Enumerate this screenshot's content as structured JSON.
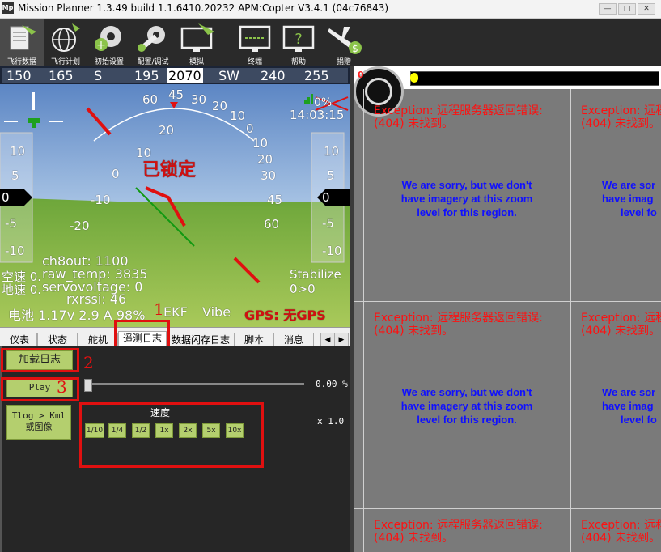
{
  "window": {
    "title": "Mission Planner 1.3.49 build 1.1.6410.20232 APM:Copter V3.4.1 (04c76843)",
    "app_icon": "Mp"
  },
  "toolbar": {
    "items": [
      {
        "label": "飞行数据",
        "icon": "flight-data-icon"
      },
      {
        "label": "飞行计划",
        "icon": "globe-icon"
      },
      {
        "label": "初始设置",
        "icon": "gear-plus-icon"
      },
      {
        "label": "配置/调试",
        "icon": "wrench-gear-icon"
      },
      {
        "label": "模拟",
        "icon": "simulation-monitor-icon"
      },
      {
        "label": "终端",
        "icon": "terminal-monitor-icon"
      },
      {
        "label": "帮助",
        "icon": "help-monitor-icon"
      },
      {
        "label": "捐赠",
        "icon": "donate-plane-icon"
      }
    ]
  },
  "compass": {
    "labels": [
      "150",
      "165",
      "S",
      "195",
      "2070",
      "SW",
      "240",
      "255"
    ]
  },
  "hud": {
    "locked": "已锁定",
    "time": "14:03:15",
    "battery_pct": "0%",
    "pitch_labels": [
      "60",
      "45",
      "30",
      "20",
      "10",
      "0",
      "-10",
      "-20"
    ],
    "roll_labels": [
      "30",
      "20",
      "10",
      "0",
      "10",
      "20",
      "30",
      "45",
      "60"
    ],
    "left_scale": [
      "10",
      "5",
      "0",
      "-5",
      "-10"
    ],
    "right_scale": [
      "10",
      "5",
      "0",
      "-5",
      "-10"
    ],
    "left_value": "0",
    "right_value": "0",
    "airspeed_label": "空速 0.",
    "groundspeed_label": "地速 0.",
    "ch8out": "ch8out: 1100",
    "raw_temp": "raw_temp: 3835",
    "servovoltage": "servovoltage: 0",
    "rxrssi": "rxrssi: 46",
    "mode": "Stabilize",
    "wp": "0>0",
    "battery": "电池 1.17v 2.9 A 98%",
    "ekf": "EKF",
    "vibe": "Vibe",
    "gps": "GPS: 无GPS"
  },
  "tabs": {
    "items": [
      "仪表",
      "状态",
      "舵机",
      "遥测日志",
      "数据闪存日志",
      "脚本",
      "消息"
    ],
    "active": "遥测日志"
  },
  "tlog": {
    "load_log": "加载日志",
    "play": "Play",
    "progress_text": "0.00 %",
    "progress_fraction": 0,
    "tlog_kml": "Tlog > Kml\n或图像",
    "speed_label": "速度",
    "speed_value": "x 1.0",
    "speeds": [
      "1/10",
      "1/4",
      "1/2",
      "1x",
      "2x",
      "5x",
      "10x"
    ]
  },
  "annotations": {
    "n1": "1",
    "n2": "2",
    "n3": "3"
  },
  "map": {
    "zoom": "0",
    "exception_line1": "Exception: 远程服务器返回错误:",
    "exception_line1_cut": "Exception: 远程",
    "exception_line2": "(404) 未找到。",
    "exception_line2_cut": "(404) 未找到。",
    "sorry_1": "We are sorry, but we don't",
    "sorry_2": "have imagery at this zoom",
    "sorry_3": "level for this region.",
    "sorry_1_cut": "We are sor",
    "sorry_2_cut": "have imag",
    "sorry_3_cut": "level fo"
  },
  "colors": {
    "sky": "#7fa3d1",
    "ground": "#7db041",
    "red_annotation": "#e01010",
    "button_green": "#b4cf6e"
  }
}
